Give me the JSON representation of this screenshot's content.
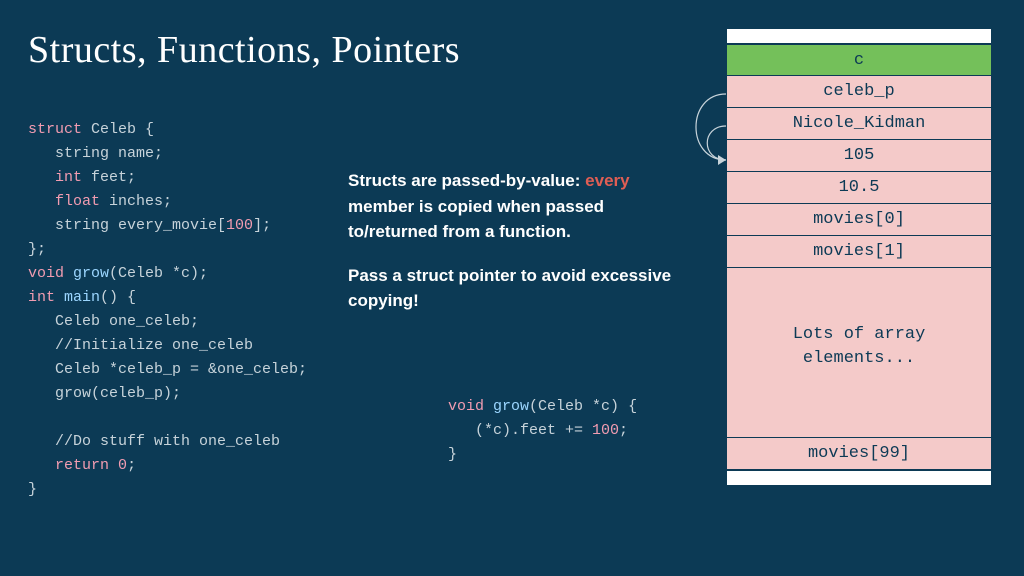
{
  "title": "Structs, Functions, Pointers",
  "code_left": {
    "l1a": "struct",
    "l1b": " Celeb {",
    "l2a": "   string name;",
    "l3a": "   ",
    "l3b": "int",
    "l3c": " feet;",
    "l4a": "   ",
    "l4b": "float",
    "l4c": " inches;",
    "l5a": "   string every_movie[",
    "l5b": "100",
    "l5c": "];",
    "l6a": "};",
    "l7a": "void",
    "l7b": " ",
    "l7c": "grow",
    "l7d": "(Celeb *c);",
    "l8a": "int",
    "l8b": " ",
    "l8c": "main",
    "l8d": "() {",
    "l9a": "   Celeb one_celeb;",
    "l10a": "   //Initialize one_celeb",
    "l11a": "   Celeb *celeb_p = &one_celeb;",
    "l12a": "   grow(celeb_p);",
    "l13a": "",
    "l14a": "   //Do stuff with one_celeb",
    "l15a": "   ",
    "l15b": "return",
    "l15c": " ",
    "l15d": "0",
    "l15e": ";",
    "l16a": "}"
  },
  "annotation": {
    "p1a": "Structs are passed-by-value: ",
    "p1b": "every",
    "p1c": " member is copied when passed to/returned from a function.",
    "p2": "Pass a struct pointer to avoid excessive copying!"
  },
  "code_right": {
    "l1a": "void",
    "l1b": " ",
    "l1c": "grow",
    "l1d": "(Celeb *c) {",
    "l2a": "   (*c).feet += ",
    "l2b": "100",
    "l2c": ";",
    "l3a": "}"
  },
  "stack": {
    "c": "c",
    "celeb_p": "celeb_p",
    "name": "Nicole_Kidman",
    "feet": "105",
    "inches": "10.5",
    "m0": "movies[0]",
    "m1": "movies[1]",
    "lots": "Lots of array\nelements...",
    "m99": "movies[99]"
  }
}
